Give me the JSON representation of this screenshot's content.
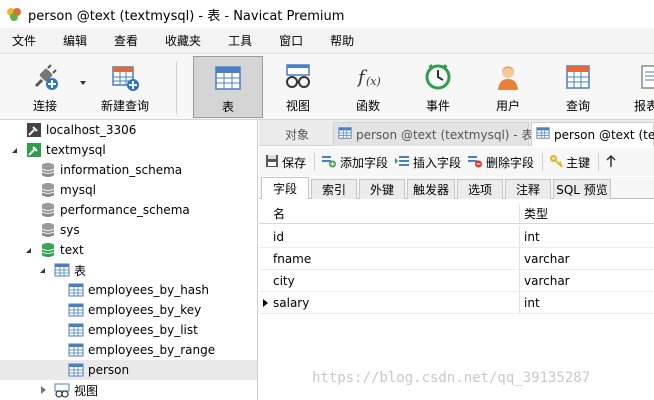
{
  "window": {
    "title": "person @text (textmysql) - 表 - Navicat Premium"
  },
  "menu": [
    "文件",
    "编辑",
    "查看",
    "收藏夹",
    "工具",
    "窗口",
    "帮助"
  ],
  "toolbar": {
    "connect": "连接",
    "new_query": "新建查询",
    "table": "表",
    "view": "视图",
    "function": "函数",
    "event": "事件",
    "user": "用户",
    "query": "查询",
    "report": "报表"
  },
  "tree": {
    "conn1": "localhost_3306",
    "conn2": "textmysql",
    "db1": "information_schema",
    "db2": "mysql",
    "db3": "performance_schema",
    "db4": "sys",
    "db5": "text",
    "tables_folder": "表",
    "t1": "employees_by_hash",
    "t2": "employees_by_key",
    "t3": "employees_by_list",
    "t4": "employees_by_range",
    "t5": "person",
    "views_folder": "视图"
  },
  "tabs": {
    "objects": "对象",
    "tab1": "person @text (textmysql) - 表",
    "tab2": "person @text (te"
  },
  "actions": {
    "save": "保存",
    "add_field": "添加字段",
    "insert_field": "插入字段",
    "delete_field": "删除字段",
    "primary_key": "主键"
  },
  "subtabs": [
    "字段",
    "索引",
    "外键",
    "触发器",
    "选项",
    "注释",
    "SQL 预览"
  ],
  "grid": {
    "col_name": "名",
    "col_type": "类型",
    "rows": [
      {
        "name": "id",
        "type": "int"
      },
      {
        "name": "fname",
        "type": "varchar"
      },
      {
        "name": "city",
        "type": "varchar"
      },
      {
        "name": "salary",
        "type": "int"
      }
    ]
  },
  "watermark": "https://blog.csdn.net/qq_39135287",
  "colors": {
    "accent_green": "#2e9e4a",
    "table_blue": "#4a7fc1",
    "selected_bg": "#d5d5d5"
  }
}
